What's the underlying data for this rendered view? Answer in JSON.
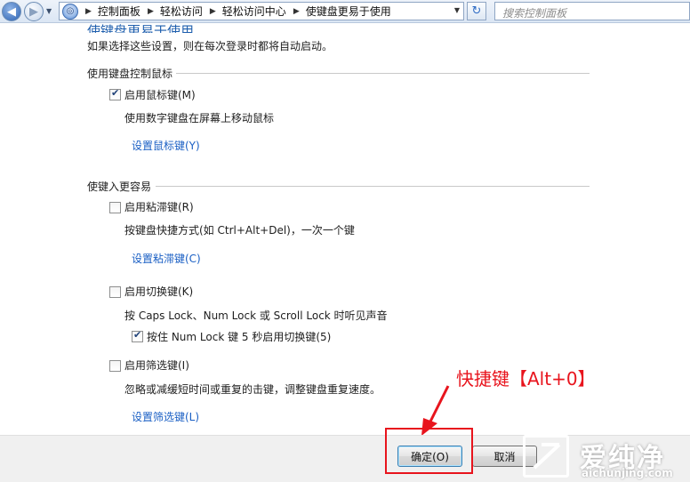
{
  "address_bar": {
    "breadcrumbs": [
      "控制面板",
      "轻松访问",
      "轻松访问中心",
      "使键盘更易于使用"
    ],
    "search_placeholder": "搜索控制面板"
  },
  "page": {
    "partial_title": "使键盘更易于使用",
    "intro": "如果选择这些设置，则在每次登录时都将自动启动。"
  },
  "mouse_section": {
    "heading": "使用键盘控制鼠标",
    "mouse_keys_label": "启用鼠标键(M)",
    "mouse_keys_checked": true,
    "mouse_keys_desc": "使用数字键盘在屏幕上移动鼠标",
    "mouse_keys_link": "设置鼠标键(Y)"
  },
  "typing_section": {
    "heading": "使键入更容易",
    "sticky_label": "启用粘滞键(R)",
    "sticky_checked": false,
    "sticky_desc": "按键盘快捷方式(如 Ctrl+Alt+Del)，一次一个键",
    "sticky_link": "设置粘滞键(C)",
    "toggle_label": "启用切换键(K)",
    "toggle_checked": false,
    "toggle_desc": "按 Caps Lock、Num Lock 或 Scroll Lock 时听见声音",
    "toggle_sub_label": "按住 Num Lock 键 5 秒启用切换键(5)",
    "toggle_sub_checked": true,
    "filter_label": "启用筛选键(I)",
    "filter_checked": false,
    "filter_desc": "忽略或减缓短时间或重复的击键，调整键盘重复速度。",
    "filter_link": "设置筛选键(L)"
  },
  "buttons": {
    "ok": "确定(O)",
    "cancel": "取消"
  },
  "annotation": {
    "text": "快捷键【Alt+0】",
    "color": "#e8141d"
  },
  "watermark": {
    "brand": "爱纯净",
    "url": "aichunjing.com"
  }
}
